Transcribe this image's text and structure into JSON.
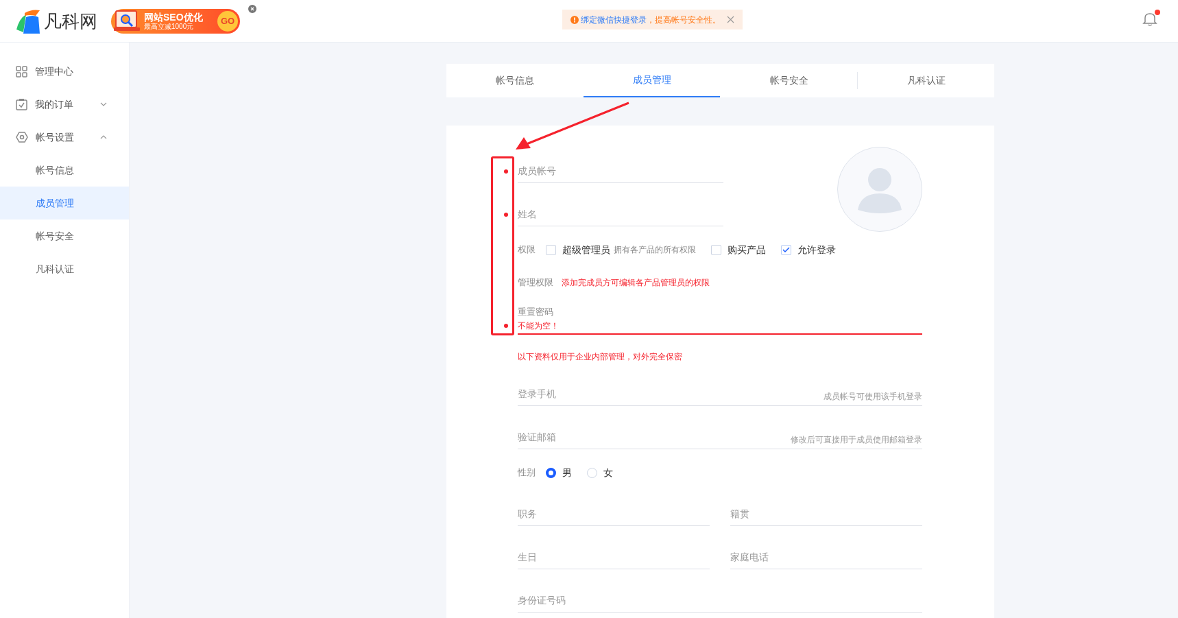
{
  "header": {
    "logo_text": "凡科网",
    "banner": {
      "title": "网站SEO优化",
      "subtitle": "最高立减1000元",
      "button": "GO"
    },
    "notice": {
      "link": "绑定微信快捷登录",
      "text": "，提高帐号安全性。"
    },
    "unread": true
  },
  "sidebar": {
    "items": [
      {
        "kind": "link",
        "label": "管理中心"
      },
      {
        "kind": "group",
        "label": "我的订单",
        "expanded": false
      },
      {
        "kind": "group",
        "label": "帐号设置",
        "expanded": true,
        "children": [
          {
            "label": "帐号信息",
            "selected": false
          },
          {
            "label": "成员管理",
            "selected": true
          },
          {
            "label": "帐号安全",
            "selected": false
          },
          {
            "label": "凡科认证",
            "selected": false
          }
        ]
      }
    ]
  },
  "tabs": [
    {
      "label": "帐号信息",
      "selected": false
    },
    {
      "label": "成员管理",
      "selected": true
    },
    {
      "label": "帐号安全",
      "selected": false
    },
    {
      "label": "凡科认证",
      "selected": false
    }
  ],
  "form": {
    "rows": [
      {
        "kind": "input",
        "placeholder": "成员帐号",
        "required": true,
        "wide": false
      },
      {
        "kind": "input",
        "placeholder": "姓名",
        "required": true,
        "wide": false
      },
      {
        "kind": "checks",
        "label": "权限",
        "options": [
          {
            "label": "超级管理员",
            "hint": "拥有各产品的所有权限",
            "checked": false
          },
          {
            "label": "购买产品",
            "checked": false
          },
          {
            "label": "允许登录",
            "checked": true
          }
        ]
      },
      {
        "kind": "info",
        "label": "管理权限",
        "text": "添加完成员方可编辑各产品管理员的权限"
      },
      {
        "kind": "password",
        "label": "重置密码",
        "error": "不能为空！",
        "required": true
      },
      {
        "kind": "note",
        "text": "以下资料仅用于企业内部管理，对外完全保密"
      },
      {
        "kind": "input",
        "placeholder": "登录手机",
        "hint": "成员帐号可使用该手机登录",
        "required": false,
        "wide": true
      },
      {
        "kind": "input",
        "placeholder": "验证邮箱",
        "hint": "修改后可直接用于成员使用邮箱登录",
        "required": false,
        "wide": true
      },
      {
        "kind": "radios",
        "label": "性别",
        "options": [
          {
            "label": "男",
            "selected": true
          },
          {
            "label": "女",
            "selected": false
          }
        ]
      },
      {
        "kind": "pair",
        "fields": [
          {
            "placeholder": "职务"
          },
          {
            "placeholder": "籍贯"
          }
        ]
      },
      {
        "kind": "pair",
        "fields": [
          {
            "placeholder": "生日"
          },
          {
            "placeholder": "家庭电话"
          }
        ]
      },
      {
        "kind": "input",
        "placeholder": "身份证号码",
        "required": false,
        "wide": true
      }
    ]
  }
}
